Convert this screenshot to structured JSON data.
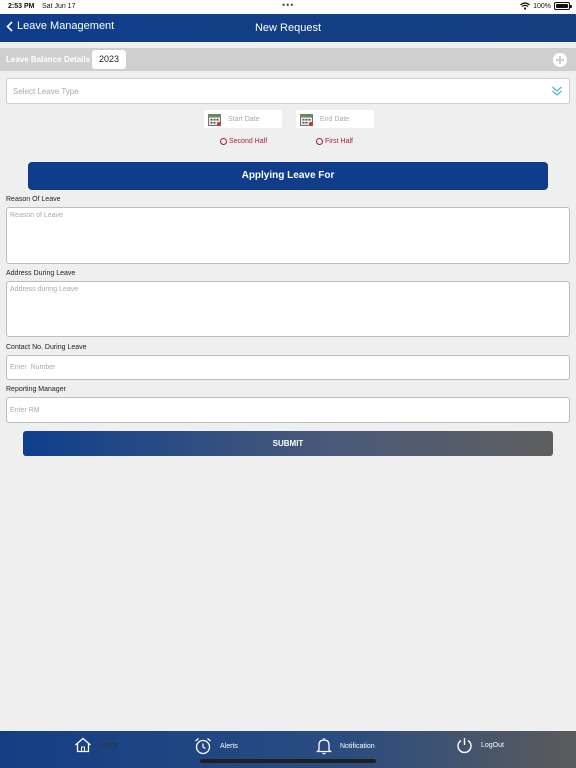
{
  "status": {
    "time": "2:53 PM",
    "date": "Sat Jun 17",
    "battery": "100%"
  },
  "nav": {
    "back_label": "Leave Management",
    "title": "New Request"
  },
  "balance": {
    "label": "Leave Balance Details",
    "year": "2023"
  },
  "form": {
    "leave_type_placeholder": "Select Leave Type",
    "start_date_placeholder": "Start Date",
    "end_date_placeholder": "End Date",
    "second_half": "Second Half",
    "first_half": "First Half",
    "applying_for": "Applying Leave For",
    "reason_label": "Reason Of Leave",
    "reason_placeholder": "Reason of Leave",
    "address_label": "Address During Leave",
    "address_placeholder": "Address during Leave",
    "contact_label": "Contact No. During Leave",
    "contact_placeholder": "Enter  Number",
    "manager_label": "Reporting Manager",
    "manager_placeholder": "Enter RM",
    "submit": "SUBMIT"
  },
  "tabs": [
    {
      "label": "Home",
      "icon": "home-icon"
    },
    {
      "label": "Alerts",
      "icon": "alarm-clock-icon"
    },
    {
      "label": "Notification",
      "icon": "bell-icon"
    },
    {
      "label": "LogOut",
      "icon": "power-icon"
    }
  ],
  "colors": {
    "primary": "#0f3d8a",
    "accent_red": "#b01c3c",
    "background": "#efefef"
  }
}
